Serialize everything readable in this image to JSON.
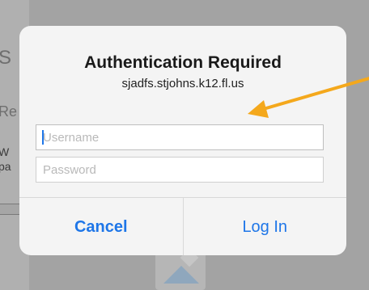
{
  "dialog": {
    "title": "Authentication Required",
    "host": "sjadfs.stjohns.k12.fl.us",
    "username_placeholder": "Username",
    "password_placeholder": "Password",
    "cancel_label": "Cancel",
    "login_label": "Log In"
  },
  "background": {
    "fragment_1": "S",
    "fragment_2": "Re",
    "fragment_3": "W",
    "fragment_4": "pa"
  },
  "colors": {
    "accent": "#1e76e8",
    "arrow": "#f4a81c"
  }
}
